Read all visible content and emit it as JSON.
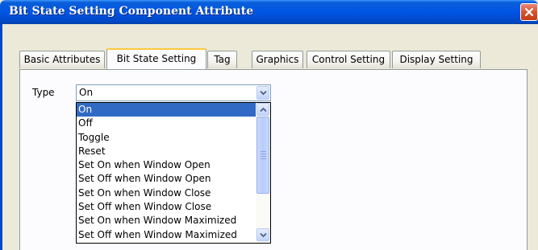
{
  "window": {
    "title": "Bit State Setting Component Attribute"
  },
  "tabs": [
    {
      "label": "Basic Attributes",
      "active": false
    },
    {
      "label": "Bit State Setting",
      "active": true
    },
    {
      "label": "Tag",
      "active": false
    },
    {
      "label": "Graphics",
      "active": false
    },
    {
      "label": "Control Setting",
      "active": false
    },
    {
      "label": "Display Setting",
      "active": false
    }
  ],
  "type_field": {
    "label": "Type",
    "value": "On",
    "options": [
      "On",
      "Off",
      "Toggle",
      "Reset",
      "Set On when Window Open",
      "Set Off when Window Open",
      "Set On when Window Close",
      "Set Off when Window Close",
      "Set On when Window Maximized",
      "Set Off when Window Maximized"
    ],
    "selected_index": 0
  },
  "colors": {
    "titlebar": "#0055e5",
    "selection": "#316ac5",
    "close_button": "#d6532f",
    "dialog_background": "#ece9d8"
  },
  "icons": [
    "close-icon",
    "chevron-down-icon",
    "scroll-up-icon",
    "scroll-down-icon"
  ]
}
